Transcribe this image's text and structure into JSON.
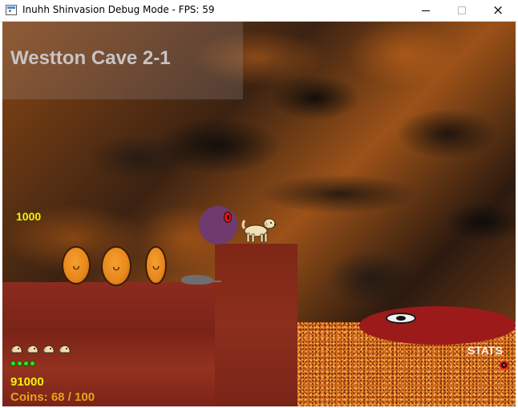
{
  "window": {
    "title": "Inuhh Shinvasion Debug Mode - FPS: 59",
    "icon": "app-window-icon",
    "buttons": {
      "minimize": "minimize-icon",
      "maximize": "maximize-icon",
      "close": "×"
    }
  },
  "hud": {
    "level_name": "Westton Cave 2-1",
    "floating_score": "1000",
    "score_total": "91000",
    "coins": "Coins: 68 / 100",
    "lives_count": 4,
    "health_pips": 4,
    "stats_label": "STATS"
  },
  "colors": {
    "hud_yellow": "#f2f20a",
    "coins_orange": "#e8a318",
    "pip_green": "#36e01f",
    "ground_red": "#8c2b1e",
    "lava_orange": "#d46a1a"
  },
  "sprites": [
    "pumpkin-enemy",
    "pumpkin-enemy",
    "pumpkin-enemy",
    "rat-enemy",
    "purple-orb-enemy",
    "dog-player",
    "portal-disc"
  ]
}
